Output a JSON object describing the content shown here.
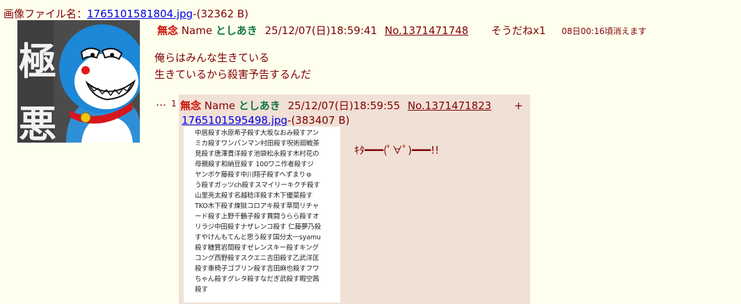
{
  "op": {
    "file_label": "画像ファイル名：",
    "file_name": "1765101581804.jpg",
    "file_size": "-(32362 B)",
    "subject": "無念",
    "name_label": "Name",
    "name": "としあき",
    "datetime": "25/12/07(日)18:59:41",
    "number": "No.1371471748",
    "sodane": "そうだねx1",
    "delete_note": "08日00:16頃消えます",
    "body_lines": [
      "俺らはみんな生きている",
      "生きているから殺害予告するんだ"
    ],
    "thumb_text": "極悪"
  },
  "reply": {
    "ellipsis": "…",
    "index": "1",
    "subject": "無念",
    "name_label": "Name",
    "name": "としあき",
    "datetime": "25/12/07(日)18:59:55",
    "number": "No.1371471823",
    "sodane": "+",
    "file_name": "1765101595498.jpg",
    "file_size": "-(383407 B)",
    "comment": "ｷﾀ━━━(ﾟ∀ﾟ)━━━!!",
    "image_text_lines": [
      "中居殺す水原希子殺す大坂なおみ殺すアン",
      "ミカ殺すワンパンマン村田殺す呪術廻戦茶",
      "見殺す唐澤貴洋殺す池袋松永殺す木村花の",
      "母親殺す和納豆殺す 100ワニ作者殺すジ",
      "ヤンボケ藤殺す中川翔子殺すへずまりゅ",
      "う殺すガッツch殺すスマイリーキクチ殺す",
      "山里亮太殺す名越稔洋殺す木下優菜殺す",
      "TKO木下殺す煉獄コロアキ殺す草間リチャ",
      "ード殺す上野千鶴子殺す貫闘うらら殺すオ",
      "リラジ中田殺すナザレンコ殺す 仁藤夢乃殺",
      "すやけんもてんと思う殺す国分太一syamu",
      "殺す糖質岩間殺すゼレンスキー殺すキング",
      "コング西野殺すスクエニ吉田殺す乙武洋匡",
      "殺す車椅子ゴブリン殺す吉田麻也殺すフワ",
      "ちゃん殺すグレタ殺すなだぎ武殺す暇空茜",
      "殺す"
    ]
  }
}
